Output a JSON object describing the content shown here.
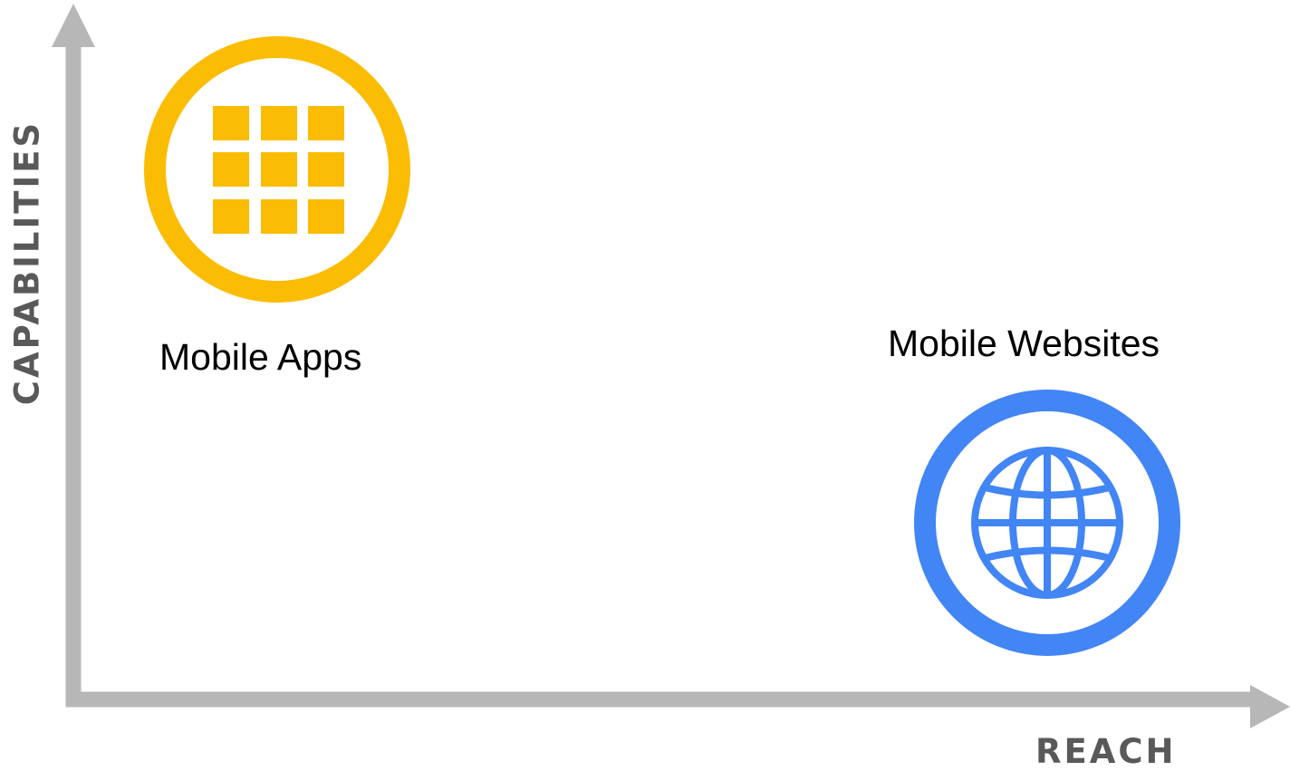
{
  "axes": {
    "x_label": "REACH",
    "y_label": "CAPABILITIES",
    "color": "#b7b7b7",
    "label_color": "#595959"
  },
  "items": [
    {
      "label": "Mobile Apps",
      "icon": "app-grid-icon",
      "color": "#fbbc04"
    },
    {
      "label": "Mobile Websites",
      "icon": "globe-icon",
      "color": "#4285f4"
    }
  ]
}
